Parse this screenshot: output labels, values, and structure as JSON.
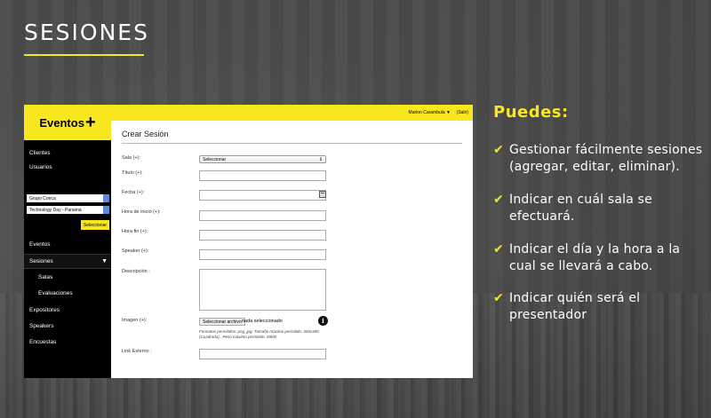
{
  "slide": {
    "title": "SESIONES",
    "accent_color": "#f8e71c"
  },
  "app": {
    "logo": "Eventos",
    "logo_plus": "+",
    "topbar": {
      "user": "Marlon Carambula ▼",
      "logout": "(Salir)"
    },
    "sidebar": {
      "items_top": [
        {
          "label": "Clientes"
        },
        {
          "label": "Usuarios"
        }
      ],
      "client_select": "Grupo Conca",
      "event_select": "Technology Day - Panamá",
      "select_button": "Seleccionar",
      "items_bottom": [
        {
          "label": "Eventos"
        },
        {
          "label": "Sesiones",
          "caret": "▼"
        },
        {
          "label": "Salas"
        },
        {
          "label": "Evaluaciones"
        },
        {
          "label": "Expositores"
        },
        {
          "label": "Speakers"
        },
        {
          "label": "Encuestas"
        }
      ]
    },
    "form": {
      "title": "Crear Sesión",
      "sala_label": "Sala (+):",
      "sala_value": "Seleccionar",
      "titulo_label": "Título (+):",
      "fecha_label": "Fecha (+):",
      "hora_inicio_label": "Hora de inicio (+):",
      "hora_fin_label": "Hora fin (+):",
      "speaker_label": "Speaker (+):",
      "descripcion_label": "Descripción :",
      "imagen_label": "Imagen (+):",
      "file_button": "Seleccionar archivo",
      "file_status": "nada seleccionado",
      "file_help": "Formatos permitidos: png, jpg. Tamaño máximo permitido: 300x300 (Cuadrada) . Peso máximo permitido: 50KB",
      "link_label": "Link Externo :"
    }
  },
  "capabilities": {
    "heading": "Puedes:",
    "check": "✔",
    "items": [
      "Gestionar fácilmente sesiones (agregar, editar, eliminar).",
      "Indicar en cuál sala se efectuará.",
      "Indicar el día y la hora a la cual se llevará a cabo.",
      "Indicar quién será el presentador"
    ]
  }
}
